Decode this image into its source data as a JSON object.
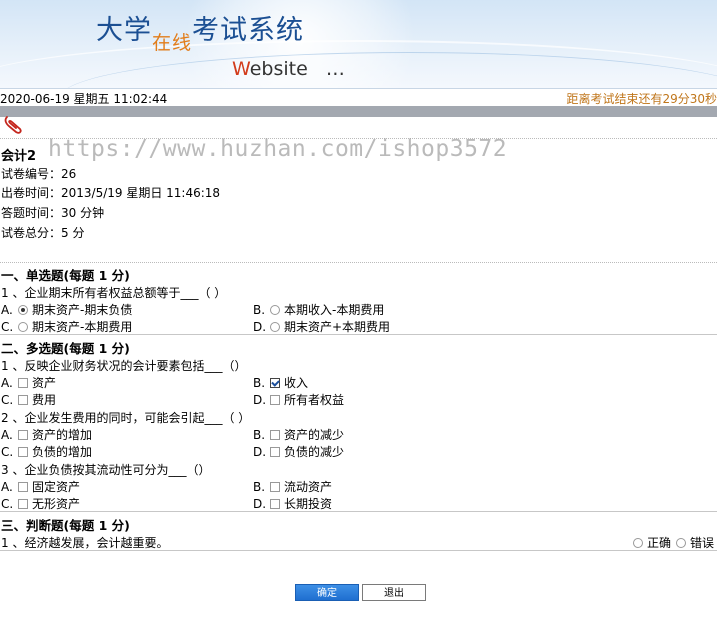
{
  "header": {
    "logo_main_1": "大学",
    "logo_small": "在线",
    "logo_main_2": "考试系统",
    "website_w": "W",
    "website_rest": "ebsite",
    "website_dots": "…"
  },
  "status": {
    "datetime": "2020-06-19 星期五 11:02:44",
    "countdown": "距离考试结束还有29分30秒"
  },
  "watermark": "https://www.huzhan.com/ishop3572",
  "paper": {
    "title": "会计2",
    "id_line": "试卷编号：26",
    "created_line": "出卷时间：2013/5/19 星期日 11:46:18",
    "duration_line": "答题时间：30 分钟",
    "total_line": "试卷总分：5 分"
  },
  "single": {
    "heading": "一、单选题(每题 1 分)",
    "questions": [
      {
        "text": "1 、企业期末所有者权益总额等于___（  ）",
        "options": [
          {
            "letter": "A.",
            "text": "期末资产-期末负债",
            "selected": true
          },
          {
            "letter": "B.",
            "text": "本期收入-本期费用",
            "selected": false
          },
          {
            "letter": "C.",
            "text": "期末资产-本期费用",
            "selected": false
          },
          {
            "letter": "D.",
            "text": "期末资产+本期费用",
            "selected": false
          }
        ]
      }
    ]
  },
  "multi": {
    "heading": "二、多选题(每题 1 分)",
    "questions": [
      {
        "text": "1 、反映企业财务状况的会计要素包括___（）",
        "options": [
          {
            "letter": "A.",
            "text": "资产",
            "checked": false
          },
          {
            "letter": "B.",
            "text": "收入",
            "checked": true
          },
          {
            "letter": "C.",
            "text": "费用",
            "checked": false
          },
          {
            "letter": "D.",
            "text": "所有者权益",
            "checked": false
          }
        ]
      },
      {
        "text": "2 、企业发生费用的同时，可能会引起___（     ）",
        "options": [
          {
            "letter": "A.",
            "text": "资产的增加",
            "checked": false
          },
          {
            "letter": "B.",
            "text": "资产的减少",
            "checked": false
          },
          {
            "letter": "C.",
            "text": "负债的增加",
            "checked": false
          },
          {
            "letter": "D.",
            "text": "负债的减少",
            "checked": false
          }
        ]
      },
      {
        "text": "3 、企业负债按其流动性可分为___（）",
        "options": [
          {
            "letter": "A.",
            "text": "固定资产",
            "checked": false
          },
          {
            "letter": "B.",
            "text": "流动资产",
            "checked": false
          },
          {
            "letter": "C.",
            "text": "无形资产",
            "checked": false
          },
          {
            "letter": "D.",
            "text": "长期投资",
            "checked": false
          }
        ]
      }
    ]
  },
  "judge": {
    "heading": "三、判断题(每题 1 分)",
    "questions": [
      {
        "text": "1 、经济越发展，会计越重要。",
        "true_label": "正确",
        "false_label": "错误"
      }
    ]
  },
  "buttons": {
    "submit": "确定",
    "exit": "退出"
  }
}
